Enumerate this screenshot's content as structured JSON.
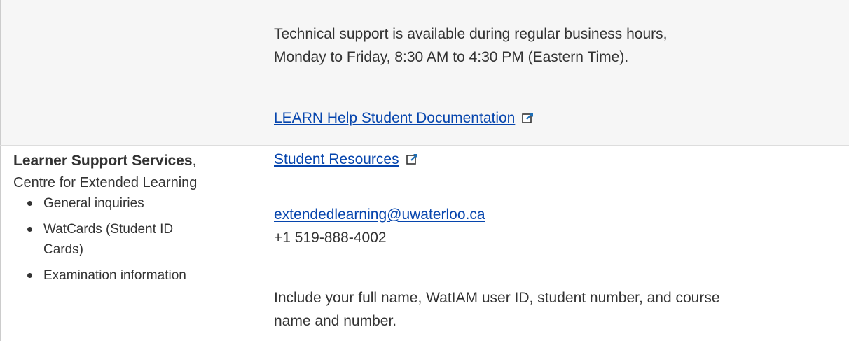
{
  "tech_support": {
    "hours_line1": "Technical support is available during regular business hours,",
    "hours_line2": "Monday to Friday, 8:30 AM to 4:30 PM (Eastern Time).",
    "doc_link": "LEARN Help Student Documentation"
  },
  "learner_support": {
    "name_bold": "Learner Support Services",
    "name_comma": ",",
    "org": "Centre for Extended Learning",
    "topics": [
      "General inquiries",
      "WatCards (Student ID",
      "Cards)",
      "Examination information"
    ],
    "resources_link": "Student Resources",
    "email": "extendedlearning@uwaterloo.ca",
    "phone": "+1 519-888-4002",
    "instruction_line1": "Include your full name, WatIAM user ID, student number, and course",
    "instruction_line2": "name and number."
  },
  "icons": {
    "external_link": "external-link-icon"
  },
  "colors": {
    "link": "#0645ad",
    "text": "#333333",
    "row_shade": "#f6f6f6",
    "border": "#cccccc"
  }
}
